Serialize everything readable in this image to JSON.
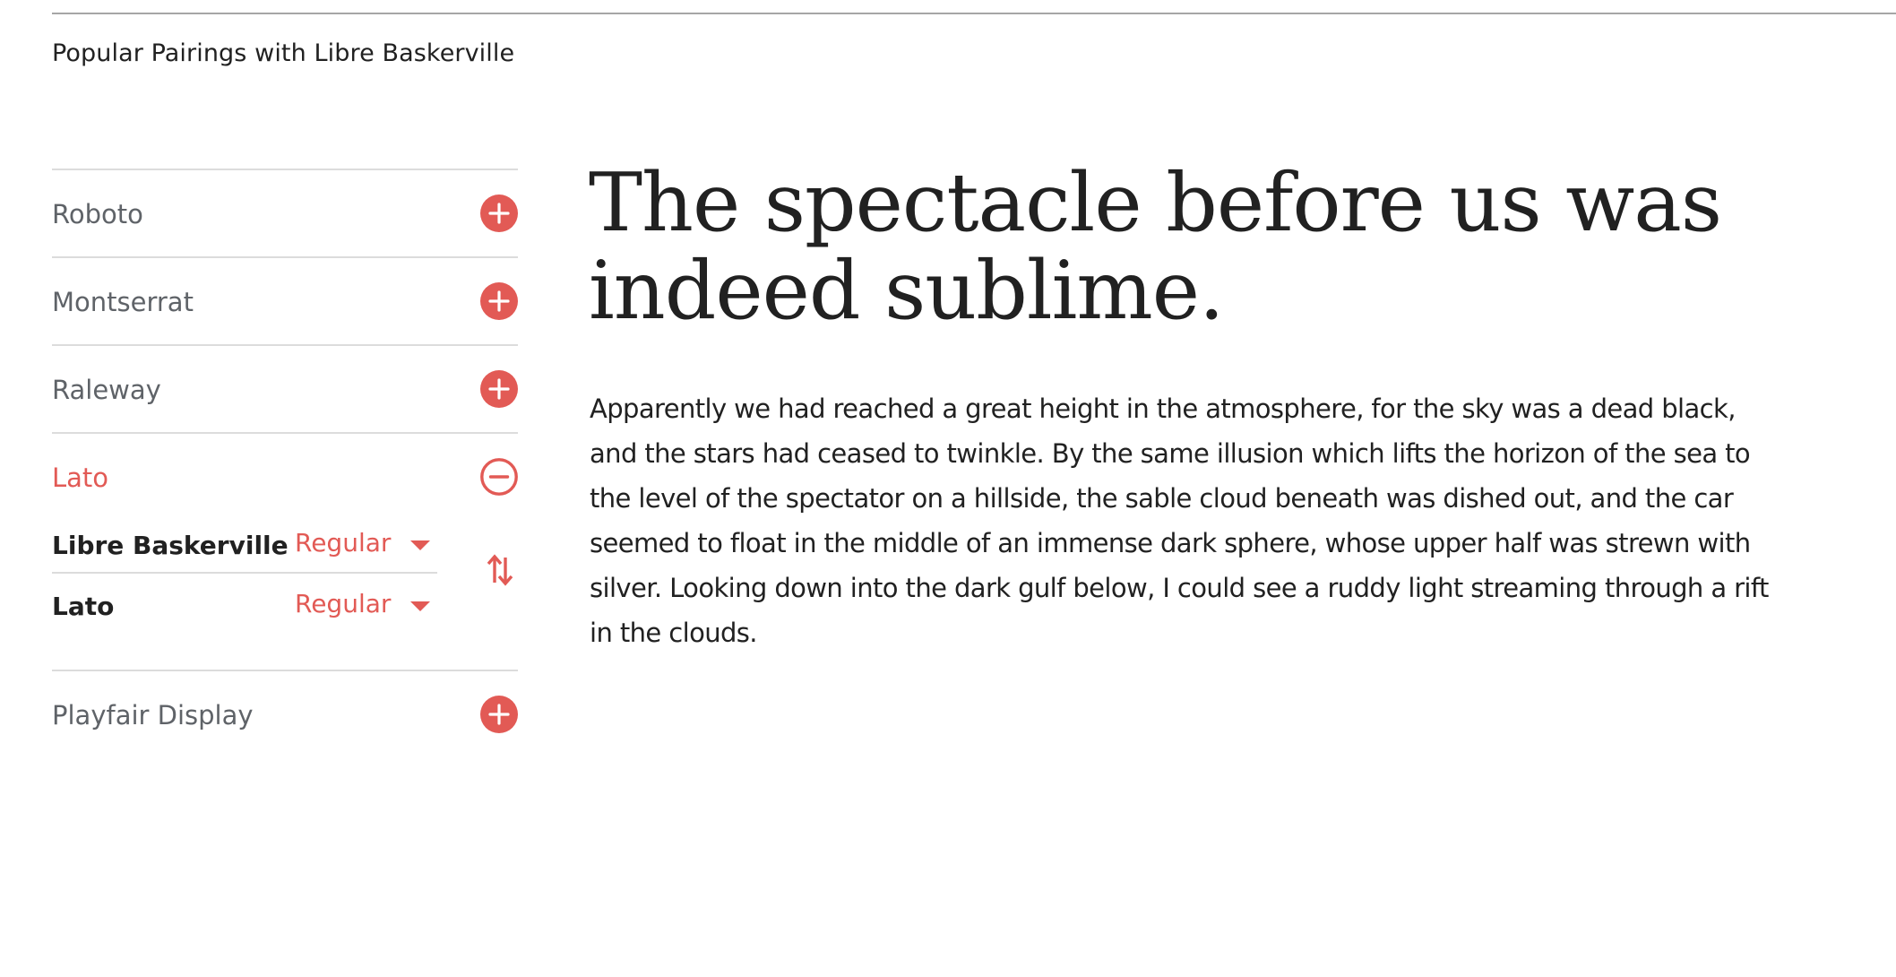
{
  "section": {
    "title": "Popular Pairings with Libre Baskerville"
  },
  "sidebar": {
    "items": [
      {
        "label": "Roboto",
        "expanded": false,
        "icon": "plus-circle-icon"
      },
      {
        "label": "Montserrat",
        "expanded": false,
        "icon": "plus-circle-icon"
      },
      {
        "label": "Raleway",
        "expanded": false,
        "icon": "plus-circle-icon"
      },
      {
        "label": "Lato",
        "expanded": true,
        "icon": "minus-circle-icon"
      },
      {
        "label": "Playfair Display",
        "expanded": false,
        "icon": "plus-circle-icon"
      }
    ],
    "pairing": {
      "rows": [
        {
          "font": "Libre Baskerville",
          "weight": "Regular"
        },
        {
          "font": "Lato",
          "weight": "Regular"
        }
      ],
      "swap_icon": "swap-vertical-icon"
    }
  },
  "preview": {
    "headline": "The spectacle before us was indeed sublime.",
    "body": "Apparently we had reached a great height in the atmosphere, for the sky was a dead black, and the stars had ceased to twinkle. By the same illusion which lifts the horizon of the sea to the level of the spectator on a hillside, the sable cloud beneath was dished out, and the car seemed to float in the middle of an immense dark sphere, whose upper half was strewn with silver. Looking down into the dark gulf below, I could see a ruddy light streaming through a rift in the clouds."
  },
  "colors": {
    "accent": "#e25a55",
    "text": "#212121",
    "muted": "#5f6368",
    "rule": "#dcdcdc"
  }
}
